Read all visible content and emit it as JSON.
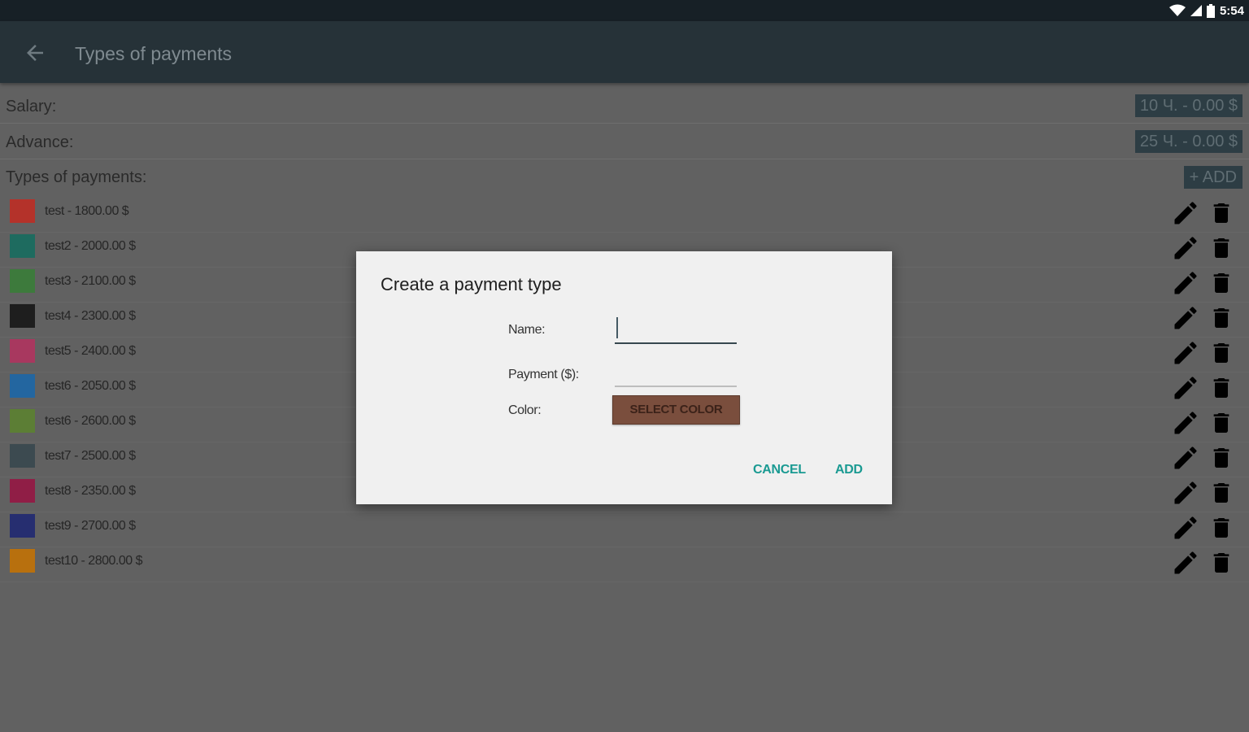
{
  "status_bar": {
    "time": "5:54"
  },
  "app_bar": {
    "title": "Types of payments"
  },
  "summary": [
    {
      "label": "Salary:",
      "value": "10 Ч. - 0.00 $"
    },
    {
      "label": "Advance:",
      "value": "25 Ч. - 0.00 $"
    }
  ],
  "types_header": {
    "label": "Types of payments:",
    "add_label": "+ ADD"
  },
  "payment_types": [
    {
      "text": "test - 1800.00 $",
      "color": "#b4322a"
    },
    {
      "text": "test2 - 2000.00 $",
      "color": "#1e6b5f"
    },
    {
      "text": "test3 - 2100.00 $",
      "color": "#3d7a3c"
    },
    {
      "text": "test4 - 2300.00 $",
      "color": "#1e1e1e"
    },
    {
      "text": "test5 - 2400.00 $",
      "color": "#a8385f"
    },
    {
      "text": "test6 - 2050.00 $",
      "color": "#2366a0"
    },
    {
      "text": "test6 - 2600.00 $",
      "color": "#5c7e35"
    },
    {
      "text": "test7 - 2500.00 $",
      "color": "#3c4a50"
    },
    {
      "text": "test8 - 2350.00 $",
      "color": "#901e46"
    },
    {
      "text": "test9 - 2700.00 $",
      "color": "#262e70"
    },
    {
      "text": "test10 - 2800.00 $",
      "color": "#b8700e"
    }
  ],
  "dialog": {
    "title": "Create a payment type",
    "name_label": "Name:",
    "name_value": "",
    "payment_label": "Payment ($):",
    "payment_value": "",
    "color_label": "Color:",
    "select_color_label": "SELECT COLOR",
    "selected_color": "#7a4e3d",
    "cancel_label": "CANCEL",
    "add_label": "ADD"
  },
  "colors": {
    "accent": "#1a9a92",
    "appbar": "#263238",
    "overlay_bg": "#616161"
  }
}
